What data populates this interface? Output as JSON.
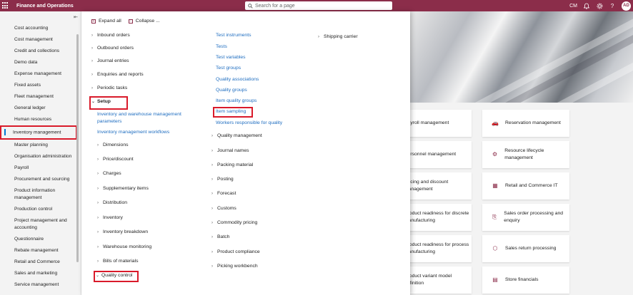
{
  "topbar": {
    "app_title": "Finance and Operations",
    "search_placeholder": "Search for a page",
    "company": "CM",
    "avatar_initials": "AD"
  },
  "leftnav": {
    "items": [
      "Cost accounting",
      "Cost management",
      "Credit and collections",
      "Demo data",
      "Expense management",
      "Fixed assets",
      "Fleet management",
      "General ledger",
      "Human resources",
      "Inventory management",
      "Master planning",
      "Organisation administration",
      "Payroll",
      "Procurement and sourcing",
      "Product information management",
      "Production control",
      "Project management and accounting",
      "Questionnaire",
      "Rebate management",
      "Retail and Commerce",
      "Sales and marketing",
      "Service management"
    ],
    "selected": "Inventory management"
  },
  "flyout": {
    "expand_all": "Expand all",
    "collapse": "Collapse ...",
    "col1": {
      "top_groups": [
        "Inbound orders",
        "Outbound orders",
        "Journal entries",
        "Enquiries and reports",
        "Periodic tasks"
      ],
      "setup": "Setup",
      "setup_links": [
        "Inventory and warehouse management parameters",
        "Inventory management workflows"
      ],
      "setup_groups": [
        "Dimensions",
        "Price/discount",
        "Charges",
        "Supplementary items",
        "Distribution",
        "Inventory",
        "Inventory breakdown",
        "Warehouse monitoring",
        "Bills of materials"
      ],
      "quality_control": "Quality control"
    },
    "col2": {
      "links": [
        "Test instruments",
        "Tests",
        "Test variables",
        "Test groups",
        "Quality associations",
        "Quality groups",
        "Item quality groups",
        "Item sampling",
        "Workers responsible for quality"
      ],
      "groups": [
        "Quality management",
        "Journal names",
        "Packing material",
        "Posting",
        "Forecast",
        "Customs",
        "Commodity pricing",
        "Batch",
        "Product compliance",
        "Picking workbench"
      ]
    },
    "col3": {
      "groups": [
        "Shipping carrier"
      ]
    }
  },
  "tiles": {
    "left": [
      "Payroll management",
      "Personnel management",
      "Pricing and discount management",
      "Product readiness for discrete manufacturing",
      "Product readiness for process manufacturing",
      "Product variant model definition"
    ],
    "right": [
      "Reservation management",
      "Resource lifecycle management",
      "Retail and Commerce IT",
      "Sales order processing and enquiry",
      "Sales return processing",
      "Store financials"
    ]
  }
}
